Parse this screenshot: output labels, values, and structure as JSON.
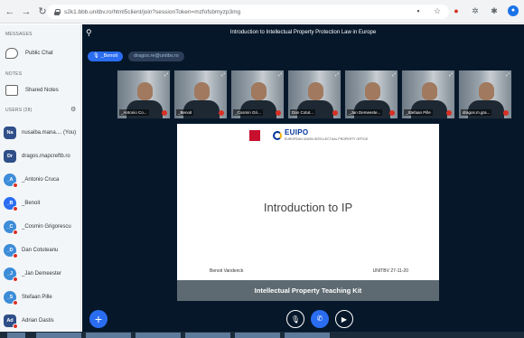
{
  "browser": {
    "url": "s2k1.bbb.unitbv.ro/html5client/join?sessionToken=mzfofsbmyzp3mg",
    "back_icon": "arrow-left-icon",
    "forward_icon": "arrow-right-icon",
    "reload_icon": "reload-icon"
  },
  "sidebar": {
    "messages_title": "MESSAGES",
    "public_chat_label": "Public Chat",
    "notes_title": "NOTES",
    "shared_notes_label": "Shared Notes",
    "users_title": "USERS (28)",
    "users": [
      {
        "initials": "Na",
        "name": "nusaiba.mana.... (You)",
        "color": "#2f4f88",
        "round": false
      },
      {
        "initials": "Dr",
        "name": "dragos.mapcreftb.ro",
        "color": "#2f4f88",
        "round": false
      },
      {
        "initials": "_A",
        "name": "_Antonio Cruca",
        "color": "#3c8cd8",
        "round": true
      },
      {
        "initials": "_B",
        "name": "_Benoit",
        "color": "#2a6df1",
        "round": true
      },
      {
        "initials": "_C",
        "name": "_Cosmin Grigorescu",
        "color": "#3c8cd8",
        "round": true
      },
      {
        "initials": "_D",
        "name": "Dan Cotuteanu",
        "color": "#3c8cd8",
        "round": true
      },
      {
        "initials": "_J",
        "name": "_Jan Demeester",
        "color": "#3c8cd8",
        "round": true
      },
      {
        "initials": "_S",
        "name": "Stefaan Pille",
        "color": "#3c8cd8",
        "round": true
      },
      {
        "initials": "Ad",
        "name": "Adrian Dastis",
        "color": "#2f4f88",
        "round": false
      }
    ]
  },
  "main": {
    "title": "Introduction to Intellectual Property Protection Law in Europe",
    "talking_user": "_Benoit",
    "talking_email": "dragos.re@unitbv.ro",
    "videos": [
      {
        "label": "_Antonio Co..."
      },
      {
        "label": "_Benoit"
      },
      {
        "label": "_Cosmin Gri..."
      },
      {
        "label": "Dan Cotut..."
      },
      {
        "label": "_Jan Demeeste..."
      },
      {
        "label": "_Stefaan Pille"
      },
      {
        "label": "dragos.m.gra..."
      }
    ]
  },
  "slide": {
    "title": "Introduction to IP",
    "logo_brand": "EUIPO",
    "logo_sub": "EUROPEAN UNION INTELLECTUAL PROPERTY OFFICE",
    "footer_left": "Benoit Vandenck",
    "footer_right": "UNITBV 27-11-20",
    "band_text": "Intellectual Property Teaching Kit"
  },
  "controls": {
    "add_icon": "plus-icon",
    "mic_icon": "microphone-muted-icon",
    "phone_icon": "phone-icon",
    "video_icon": "video-icon"
  }
}
